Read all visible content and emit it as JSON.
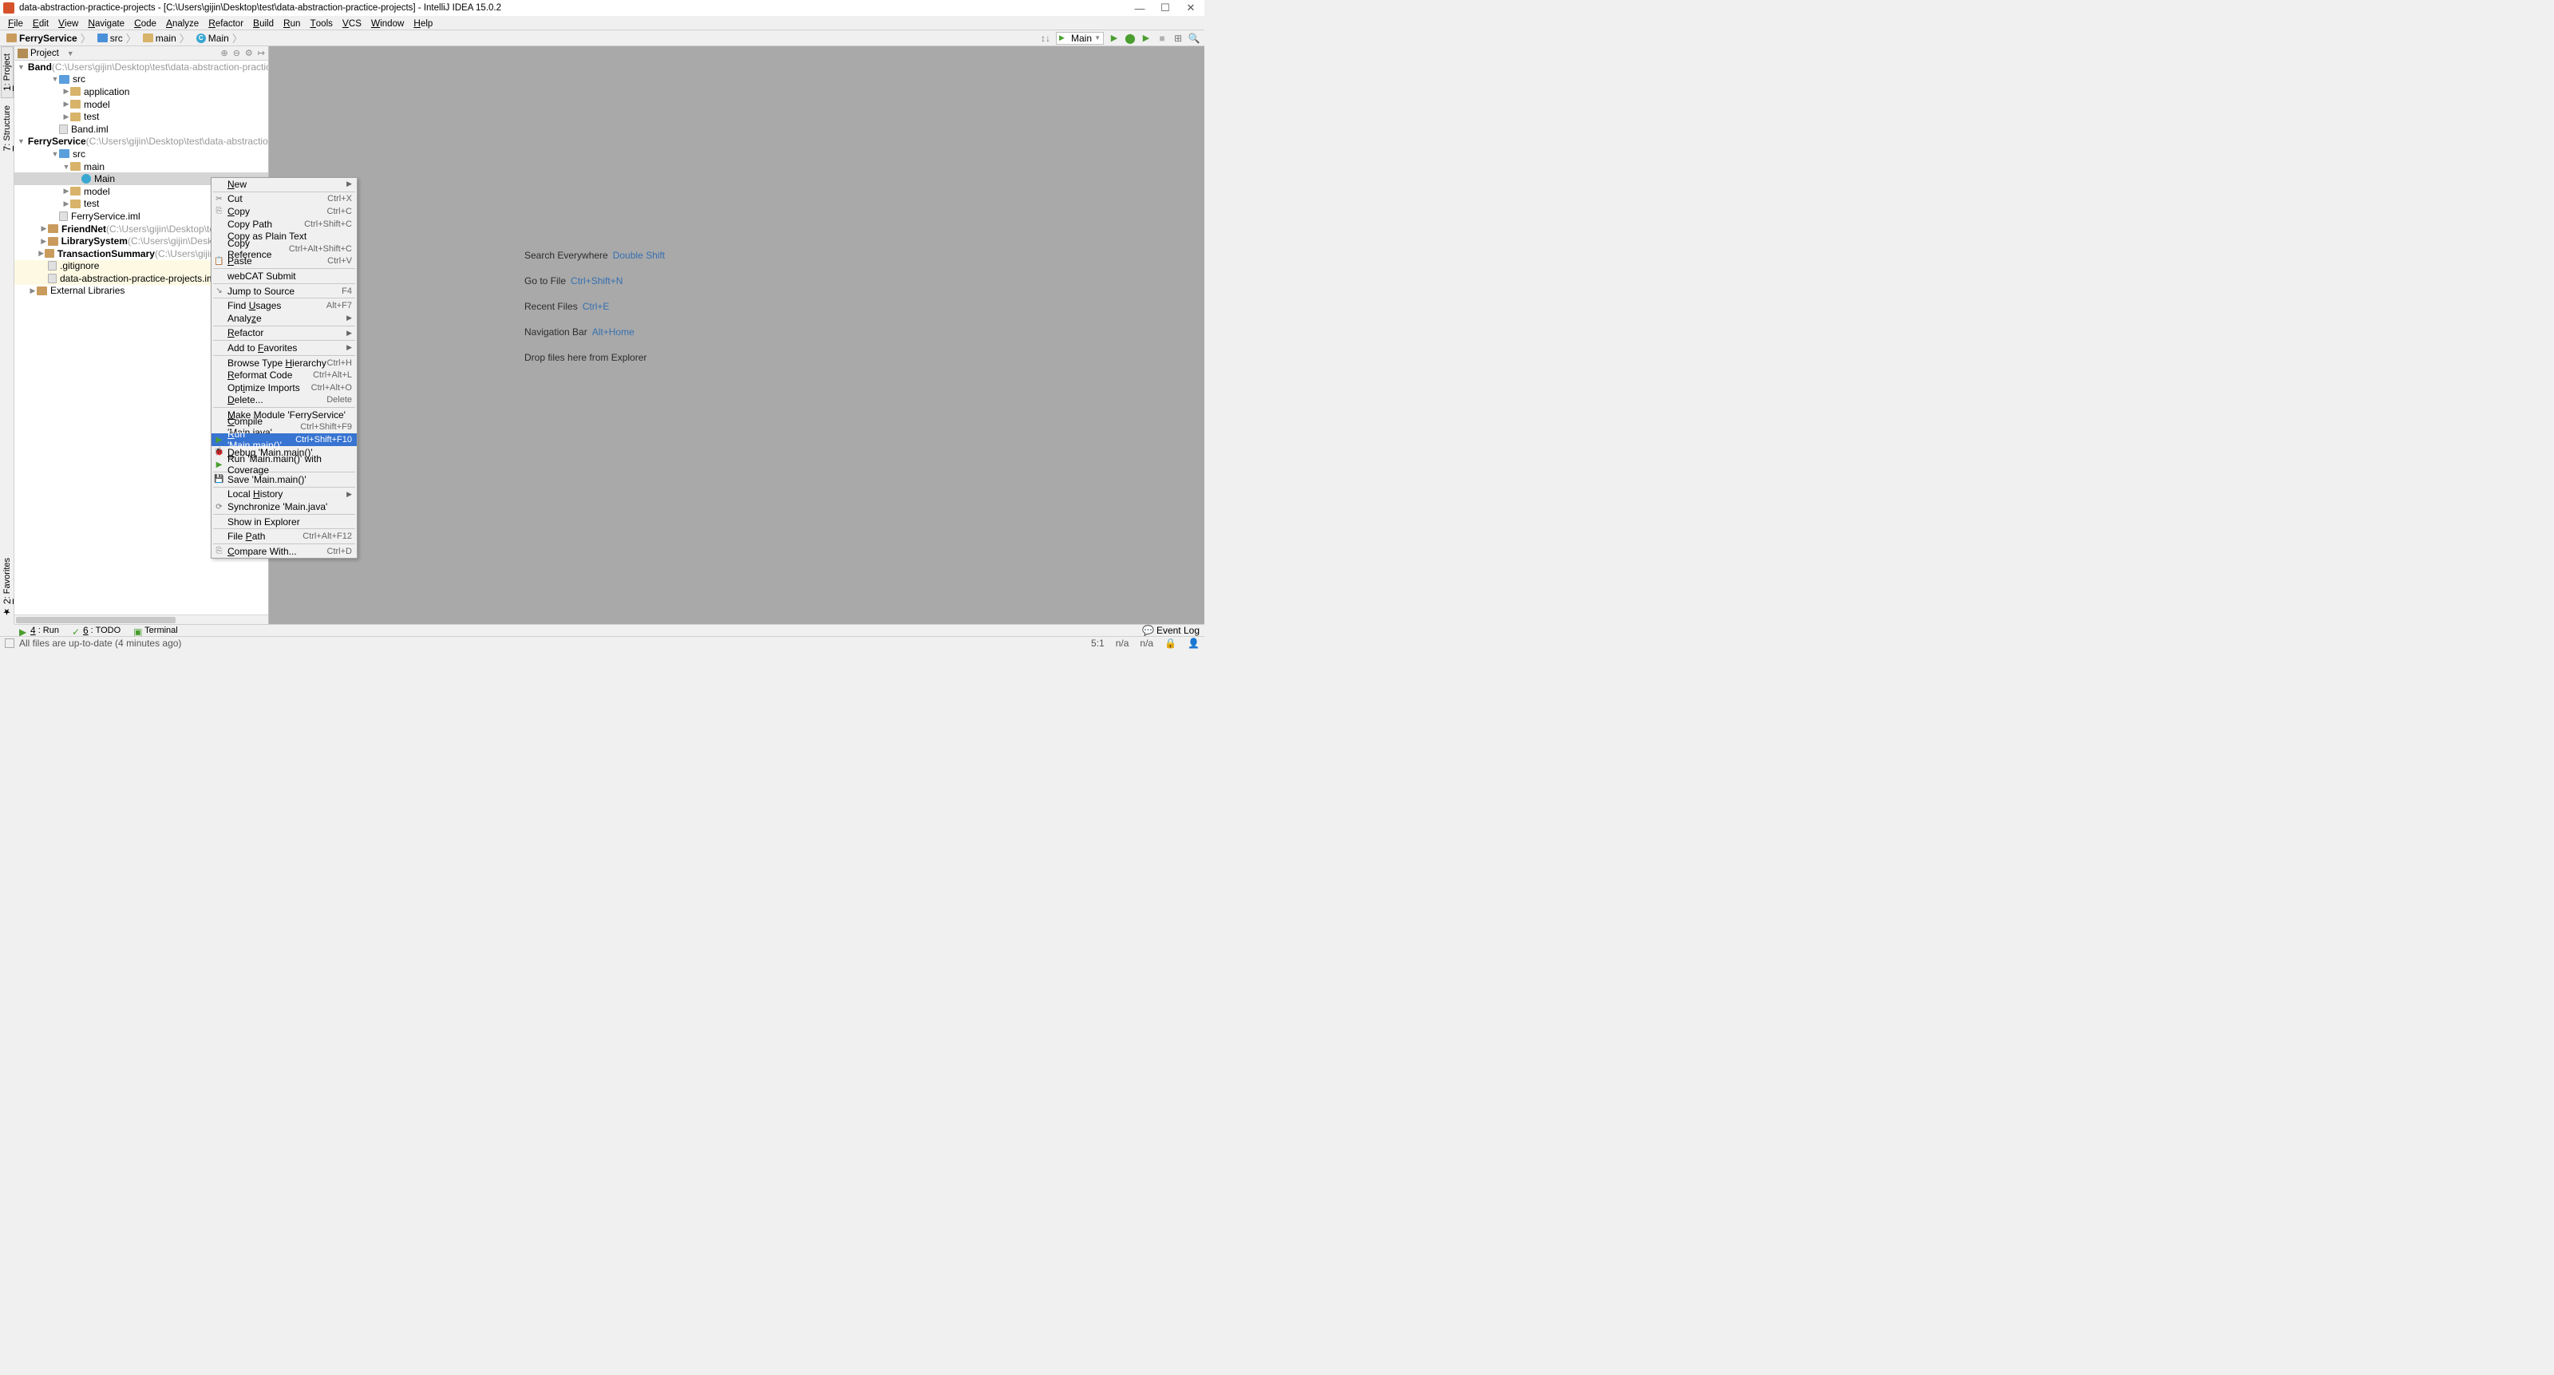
{
  "titlebar": {
    "title": "data-abstraction-practice-projects - [C:\\Users\\gijin\\Desktop\\test\\data-abstraction-practice-projects] - IntelliJ IDEA 15.0.2"
  },
  "menu": [
    "File",
    "Edit",
    "View",
    "Navigate",
    "Code",
    "Analyze",
    "Refactor",
    "Build",
    "Run",
    "Tools",
    "VCS",
    "Window",
    "Help"
  ],
  "breadcrumbs": [
    {
      "icon": "module",
      "label": "FerryService"
    },
    {
      "icon": "folder-src",
      "label": "src"
    },
    {
      "icon": "folder",
      "label": "main"
    },
    {
      "icon": "class",
      "label": "Main"
    }
  ],
  "run_config": "Main",
  "panel": {
    "title": "Project"
  },
  "tree": [
    {
      "depth": 0,
      "arrow": "▼",
      "icon": "module",
      "bold": "Band",
      "path": " (C:\\Users\\gijin\\Desktop\\test\\data-abstraction-practice-proje"
    },
    {
      "depth": 1,
      "arrow": "▼",
      "icon": "folder-src",
      "label": "src"
    },
    {
      "depth": 2,
      "arrow": "▶",
      "icon": "folder",
      "label": "application"
    },
    {
      "depth": 2,
      "arrow": "▶",
      "icon": "folder",
      "label": "model"
    },
    {
      "depth": 2,
      "arrow": "▶",
      "icon": "folder",
      "label": "test"
    },
    {
      "depth": 1,
      "arrow": "",
      "icon": "file",
      "label": "Band.iml"
    },
    {
      "depth": 0,
      "arrow": "▼",
      "icon": "module",
      "bold": "FerryService",
      "path": " (C:\\Users\\gijin\\Desktop\\test\\data-abstraction-practic"
    },
    {
      "depth": 1,
      "arrow": "▼",
      "icon": "folder-src",
      "label": "src"
    },
    {
      "depth": 2,
      "arrow": "▼",
      "icon": "folder",
      "label": "main"
    },
    {
      "depth": 3,
      "arrow": "",
      "icon": "class",
      "label": "Main",
      "selected": true
    },
    {
      "depth": 2,
      "arrow": "▶",
      "icon": "folder",
      "label": "model"
    },
    {
      "depth": 2,
      "arrow": "▶",
      "icon": "folder",
      "label": "test"
    },
    {
      "depth": 1,
      "arrow": "",
      "icon": "file",
      "label": "FerryService.iml"
    },
    {
      "depth": 0,
      "arrow": "▶",
      "icon": "module",
      "bold": "FriendNet",
      "path": " (C:\\Users\\gijin\\Desktop\\test\\data-abst"
    },
    {
      "depth": 0,
      "arrow": "▶",
      "icon": "module",
      "bold": "LibrarySystem",
      "path": " (C:\\Users\\gijin\\Desktop\\test\\data-"
    },
    {
      "depth": 0,
      "arrow": "▶",
      "icon": "module",
      "bold": "TransactionSummary",
      "path": " (C:\\Users\\gijin\\Desktop\\tes"
    },
    {
      "depth": 0,
      "arrow": "",
      "icon": "file",
      "label": ".gitignore",
      "bg": "#fdf9e3"
    },
    {
      "depth": 0,
      "arrow": "",
      "icon": "file",
      "label": "data-abstraction-practice-projects.iml",
      "bg": "#fdf9e3"
    },
    {
      "depth": -1,
      "arrow": "▶",
      "icon": "lib",
      "label": "External Libraries"
    }
  ],
  "context_menu": [
    {
      "label": "New",
      "submenu": true,
      "mnemonic": "N"
    },
    {
      "type": "sep"
    },
    {
      "label": "Cut",
      "shortcut": "Ctrl+X",
      "icon": "✂",
      "mnemonic": ""
    },
    {
      "label": "Copy",
      "shortcut": "Ctrl+C",
      "icon": "⎘",
      "mnemonic": "C"
    },
    {
      "label": "Copy Path",
      "shortcut": "Ctrl+Shift+C"
    },
    {
      "label": "Copy as Plain Text"
    },
    {
      "label": "Copy Reference",
      "shortcut": "Ctrl+Alt+Shift+C"
    },
    {
      "label": "Paste",
      "shortcut": "Ctrl+V",
      "icon": "📋",
      "mnemonic": "P"
    },
    {
      "type": "sep"
    },
    {
      "label": "webCAT Submit"
    },
    {
      "type": "sep"
    },
    {
      "label": "Jump to Source",
      "shortcut": "F4",
      "icon": "↘"
    },
    {
      "type": "sep"
    },
    {
      "label": "Find Usages",
      "shortcut": "Alt+F7",
      "mnemonic": "U"
    },
    {
      "label": "Analyze",
      "submenu": true,
      "mnemonic": "z"
    },
    {
      "type": "sep"
    },
    {
      "label": "Refactor",
      "submenu": true,
      "mnemonic": "R"
    },
    {
      "type": "sep"
    },
    {
      "label": "Add to Favorites",
      "submenu": true,
      "mnemonic": "F"
    },
    {
      "type": "sep"
    },
    {
      "label": "Browse Type Hierarchy",
      "shortcut": "Ctrl+H",
      "mnemonic": "H"
    },
    {
      "label": "Reformat Code",
      "shortcut": "Ctrl+Alt+L",
      "mnemonic": "R"
    },
    {
      "label": "Optimize Imports",
      "shortcut": "Ctrl+Alt+O",
      "mnemonic": "I"
    },
    {
      "label": "Delete...",
      "shortcut": "Delete",
      "mnemonic": "D"
    },
    {
      "type": "sep"
    },
    {
      "label": "Make Module 'FerryService'",
      "mnemonic": "M"
    },
    {
      "label": "Compile 'Main.java'",
      "shortcut": "Ctrl+Shift+F9",
      "mnemonic": "C"
    },
    {
      "label": "Run 'Main.main()'",
      "shortcut": "Ctrl+Shift+F10",
      "icon": "▶",
      "iconColor": "#4a9e2f",
      "selected": true,
      "mnemonic": "R"
    },
    {
      "label": "Debug 'Main.main()'",
      "icon": "🐞",
      "mnemonic": "D"
    },
    {
      "label": "Run 'Main.main()' with Coverage",
      "icon": "▶",
      "iconColor": "#4a9e2f"
    },
    {
      "type": "sep"
    },
    {
      "label": "Save 'Main.main()'",
      "icon": "💾"
    },
    {
      "type": "sep"
    },
    {
      "label": "Local History",
      "submenu": true,
      "mnemonic": "H"
    },
    {
      "label": "Synchronize 'Main.java'",
      "icon": "⟳"
    },
    {
      "type": "sep"
    },
    {
      "label": "Show in Explorer"
    },
    {
      "type": "sep"
    },
    {
      "label": "File Path",
      "shortcut": "Ctrl+Alt+F12",
      "mnemonic": "P"
    },
    {
      "type": "sep"
    },
    {
      "label": "Compare With...",
      "shortcut": "Ctrl+D",
      "icon": "⎘",
      "mnemonic": "C"
    }
  ],
  "hints": [
    {
      "label": "Search Everywhere",
      "key": "Double Shift"
    },
    {
      "label": "Go to File",
      "key": "Ctrl+Shift+N"
    },
    {
      "label": "Recent Files",
      "key": "Ctrl+E"
    },
    {
      "label": "Navigation Bar",
      "key": "Alt+Home"
    },
    {
      "label": "Drop files here from Explorer",
      "key": ""
    }
  ],
  "left_tabs": [
    {
      "num": "1",
      "label": "Project",
      "active": true
    },
    {
      "num": "7",
      "label": "Structure"
    }
  ],
  "left_bottom_tab": {
    "num": "2",
    "label": "Favorites"
  },
  "bottom_tabs": [
    {
      "num": "4",
      "label": "Run",
      "icon": "▶"
    },
    {
      "num": "6",
      "label": "TODO",
      "icon": "✓"
    },
    {
      "num": "",
      "label": "Terminal",
      "icon": "▣"
    }
  ],
  "event_log": "Event Log",
  "status": {
    "message": "All files are up-to-date (4 minutes ago)",
    "pos": "5:1",
    "na1": "n/a",
    "na2": "n/a"
  }
}
